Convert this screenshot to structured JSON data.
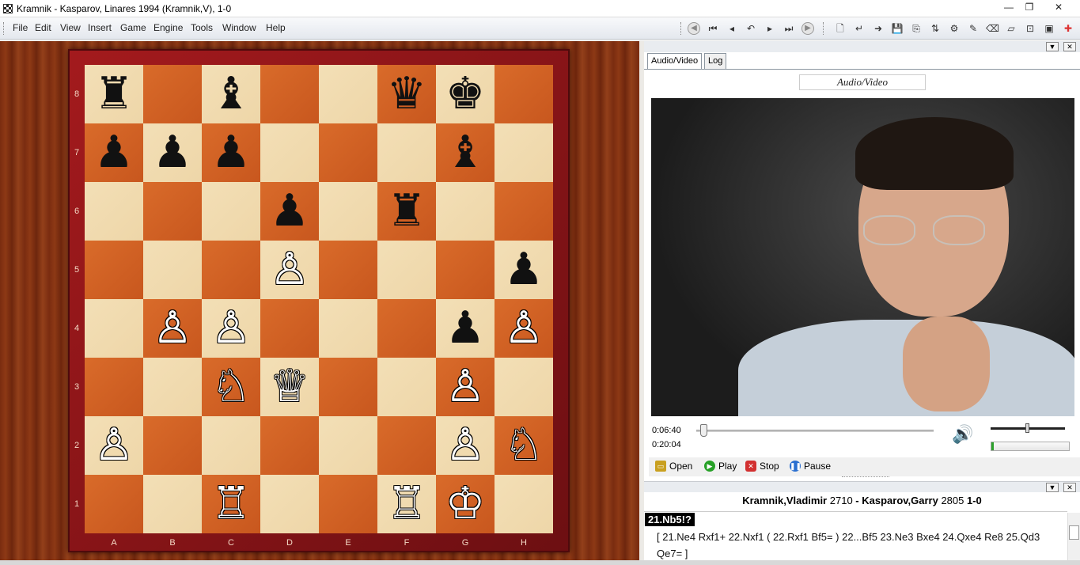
{
  "window": {
    "title": "Kramnik - Kasparov, Linares 1994  (Kramnik,V), 1-0",
    "min": "—",
    "max": "❐",
    "close": "✕"
  },
  "menu": [
    "File",
    "Edit",
    "View",
    "Insert",
    "Game",
    "Engine",
    "Tools",
    "Window",
    "Help"
  ],
  "toolbar_icons": [
    "back-circle-icon",
    "first-move-icon",
    "prev-move-icon",
    "undo-icon",
    "next-move-icon",
    "last-move-icon",
    "forward-circle-icon",
    "new-document-icon",
    "take-back-icon",
    "forward-arrow-icon",
    "save-icon",
    "save-as-icon",
    "sort-icon",
    "settings-icon",
    "edit-icon",
    "eraser-icon",
    "camera-icon",
    "media-icon",
    "add-icon"
  ],
  "board": {
    "ranks": [
      "8",
      "7",
      "6",
      "5",
      "4",
      "3",
      "2",
      "1"
    ],
    "files": [
      "A",
      "B",
      "C",
      "D",
      "E",
      "F",
      "G",
      "H"
    ],
    "rows": [
      [
        "♜",
        "",
        "♝",
        "",
        "",
        "♛",
        "♚",
        ""
      ],
      [
        "♟",
        "♟",
        "♟",
        "",
        "",
        "",
        "♝",
        ""
      ],
      [
        "",
        "",
        "",
        "♟",
        "",
        "♜",
        "",
        ""
      ],
      [
        "",
        "",
        "",
        "♙",
        "",
        "",
        "",
        "♟"
      ],
      [
        "",
        "♙",
        "♙",
        "",
        "",
        "",
        "♟",
        "♙"
      ],
      [
        "",
        "",
        "♘",
        "♕",
        "",
        "",
        "♙",
        ""
      ],
      [
        "♙",
        "",
        "",
        "",
        "",
        "",
        "♙",
        "♘"
      ],
      [
        "",
        "",
        "♖",
        "",
        "",
        "♖",
        "♔",
        ""
      ]
    ]
  },
  "panel": {
    "tabs": [
      "Audio/Video",
      "Log"
    ],
    "av_header": "Audio/Video",
    "time_elapsed": "0:06:40",
    "time_total": "0:20:04",
    "seek_fraction": 0.03,
    "volume_fraction": 0.5,
    "level_fraction": 0.03,
    "controls": [
      {
        "label": "Open",
        "icon": "open-folder-icon",
        "color": "#c9a020"
      },
      {
        "label": "Play",
        "icon": "play-icon",
        "color": "#27a127"
      },
      {
        "label": "Stop",
        "icon": "stop-icon",
        "color": "#d23030"
      },
      {
        "label": "Pause",
        "icon": "pause-icon",
        "color": "#2a6fd0"
      }
    ]
  },
  "game": {
    "white": "Kramnik,Vladimir",
    "white_elo": "2710",
    "sep": " - ",
    "black": "Kasparov,Garry",
    "black_elo": "2805",
    "result": "1-0",
    "current_move": "21.Nb5!?",
    "variation": "[ 21.Ne4  Rxf1+  22.Nxf1  ( 22.Rxf1  Bf5= ) 22...Bf5  23.Ne3  Bxe4  24.Qxe4  Re8  25.Qd3  Qe7= ]"
  }
}
